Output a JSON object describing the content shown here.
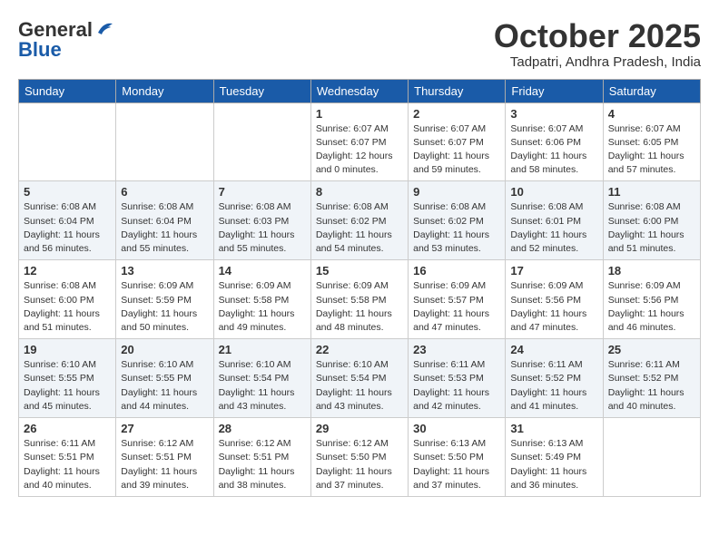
{
  "header": {
    "logo_general": "General",
    "logo_blue": "Blue",
    "month": "October 2025",
    "location": "Tadpatri, Andhra Pradesh, India"
  },
  "days_of_week": [
    "Sunday",
    "Monday",
    "Tuesday",
    "Wednesday",
    "Thursday",
    "Friday",
    "Saturday"
  ],
  "weeks": [
    [
      {
        "day": "",
        "info": ""
      },
      {
        "day": "",
        "info": ""
      },
      {
        "day": "",
        "info": ""
      },
      {
        "day": "1",
        "info": "Sunrise: 6:07 AM\nSunset: 6:07 PM\nDaylight: 12 hours\nand 0 minutes."
      },
      {
        "day": "2",
        "info": "Sunrise: 6:07 AM\nSunset: 6:07 PM\nDaylight: 11 hours\nand 59 minutes."
      },
      {
        "day": "3",
        "info": "Sunrise: 6:07 AM\nSunset: 6:06 PM\nDaylight: 11 hours\nand 58 minutes."
      },
      {
        "day": "4",
        "info": "Sunrise: 6:07 AM\nSunset: 6:05 PM\nDaylight: 11 hours\nand 57 minutes."
      }
    ],
    [
      {
        "day": "5",
        "info": "Sunrise: 6:08 AM\nSunset: 6:04 PM\nDaylight: 11 hours\nand 56 minutes."
      },
      {
        "day": "6",
        "info": "Sunrise: 6:08 AM\nSunset: 6:04 PM\nDaylight: 11 hours\nand 55 minutes."
      },
      {
        "day": "7",
        "info": "Sunrise: 6:08 AM\nSunset: 6:03 PM\nDaylight: 11 hours\nand 55 minutes."
      },
      {
        "day": "8",
        "info": "Sunrise: 6:08 AM\nSunset: 6:02 PM\nDaylight: 11 hours\nand 54 minutes."
      },
      {
        "day": "9",
        "info": "Sunrise: 6:08 AM\nSunset: 6:02 PM\nDaylight: 11 hours\nand 53 minutes."
      },
      {
        "day": "10",
        "info": "Sunrise: 6:08 AM\nSunset: 6:01 PM\nDaylight: 11 hours\nand 52 minutes."
      },
      {
        "day": "11",
        "info": "Sunrise: 6:08 AM\nSunset: 6:00 PM\nDaylight: 11 hours\nand 51 minutes."
      }
    ],
    [
      {
        "day": "12",
        "info": "Sunrise: 6:08 AM\nSunset: 6:00 PM\nDaylight: 11 hours\nand 51 minutes."
      },
      {
        "day": "13",
        "info": "Sunrise: 6:09 AM\nSunset: 5:59 PM\nDaylight: 11 hours\nand 50 minutes."
      },
      {
        "day": "14",
        "info": "Sunrise: 6:09 AM\nSunset: 5:58 PM\nDaylight: 11 hours\nand 49 minutes."
      },
      {
        "day": "15",
        "info": "Sunrise: 6:09 AM\nSunset: 5:58 PM\nDaylight: 11 hours\nand 48 minutes."
      },
      {
        "day": "16",
        "info": "Sunrise: 6:09 AM\nSunset: 5:57 PM\nDaylight: 11 hours\nand 47 minutes."
      },
      {
        "day": "17",
        "info": "Sunrise: 6:09 AM\nSunset: 5:56 PM\nDaylight: 11 hours\nand 47 minutes."
      },
      {
        "day": "18",
        "info": "Sunrise: 6:09 AM\nSunset: 5:56 PM\nDaylight: 11 hours\nand 46 minutes."
      }
    ],
    [
      {
        "day": "19",
        "info": "Sunrise: 6:10 AM\nSunset: 5:55 PM\nDaylight: 11 hours\nand 45 minutes."
      },
      {
        "day": "20",
        "info": "Sunrise: 6:10 AM\nSunset: 5:55 PM\nDaylight: 11 hours\nand 44 minutes."
      },
      {
        "day": "21",
        "info": "Sunrise: 6:10 AM\nSunset: 5:54 PM\nDaylight: 11 hours\nand 43 minutes."
      },
      {
        "day": "22",
        "info": "Sunrise: 6:10 AM\nSunset: 5:54 PM\nDaylight: 11 hours\nand 43 minutes."
      },
      {
        "day": "23",
        "info": "Sunrise: 6:11 AM\nSunset: 5:53 PM\nDaylight: 11 hours\nand 42 minutes."
      },
      {
        "day": "24",
        "info": "Sunrise: 6:11 AM\nSunset: 5:52 PM\nDaylight: 11 hours\nand 41 minutes."
      },
      {
        "day": "25",
        "info": "Sunrise: 6:11 AM\nSunset: 5:52 PM\nDaylight: 11 hours\nand 40 minutes."
      }
    ],
    [
      {
        "day": "26",
        "info": "Sunrise: 6:11 AM\nSunset: 5:51 PM\nDaylight: 11 hours\nand 40 minutes."
      },
      {
        "day": "27",
        "info": "Sunrise: 6:12 AM\nSunset: 5:51 PM\nDaylight: 11 hours\nand 39 minutes."
      },
      {
        "day": "28",
        "info": "Sunrise: 6:12 AM\nSunset: 5:51 PM\nDaylight: 11 hours\nand 38 minutes."
      },
      {
        "day": "29",
        "info": "Sunrise: 6:12 AM\nSunset: 5:50 PM\nDaylight: 11 hours\nand 37 minutes."
      },
      {
        "day": "30",
        "info": "Sunrise: 6:13 AM\nSunset: 5:50 PM\nDaylight: 11 hours\nand 37 minutes."
      },
      {
        "day": "31",
        "info": "Sunrise: 6:13 AM\nSunset: 5:49 PM\nDaylight: 11 hours\nand 36 minutes."
      },
      {
        "day": "",
        "info": ""
      }
    ]
  ]
}
